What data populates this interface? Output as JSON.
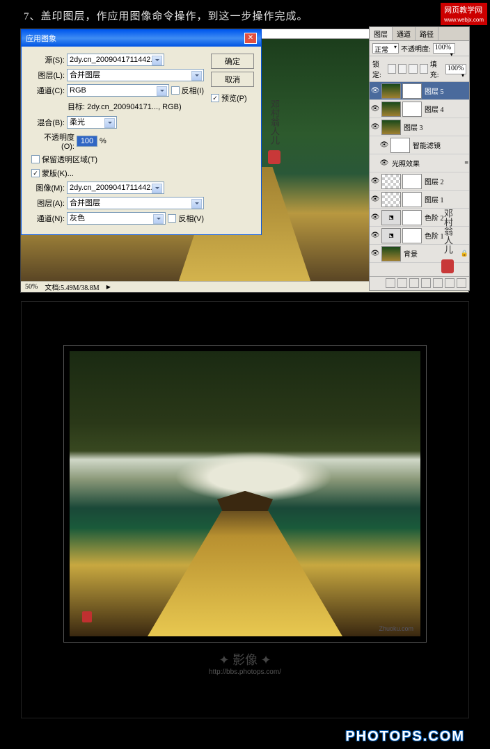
{
  "step_text": "7、盖印图层，作应用图像命令操作，到这一步操作完成。",
  "watermark_top": "网页教学网",
  "watermark_url": "www.webjx.com",
  "dialog": {
    "title": "应用图象",
    "source_lbl": "源(S):",
    "source_val": "2dy.cn_2009041711442...",
    "layer_lbl": "图层(L):",
    "layer_val": "合并图层",
    "channel_lbl": "通道(C):",
    "channel_val": "RGB",
    "invert_lbl": "反相(I)",
    "target_lbl": "目标:",
    "target_val": "2dy.cn_200904171..., RGB)",
    "blend_lbl": "混合(B):",
    "blend_val": "柔光",
    "opacity_lbl": "不透明度(O):",
    "opacity_val": "100",
    "opacity_pct": "%",
    "preserve_lbl": "保留透明区域(T)",
    "mask_lbl": "蒙版(K)...",
    "image_lbl": "图像(M):",
    "image_val": "2dy.cn_2009041711442...",
    "layer2_lbl": "图层(A):",
    "layer2_val": "合并图层",
    "channel2_lbl": "通道(N):",
    "channel2_val": "灰色",
    "invert2_lbl": "反相(V)",
    "ok": "确定",
    "cancel": "取消",
    "preview": "预览(P)"
  },
  "status": {
    "zoom": "50%",
    "doc": "文档:5.49M/38.8M"
  },
  "layers_panel": {
    "tabs": [
      "图层",
      "通道",
      "路径"
    ],
    "mode_lbl": "正常",
    "opacity_lbl": "不透明度:",
    "opacity_val": "100%",
    "lock_lbl": "锁定:",
    "fill_lbl": "填充:",
    "fill_val": "100%",
    "layers": [
      {
        "name": "图层 5",
        "sel": true,
        "thumb": "img",
        "mask": true
      },
      {
        "name": "图层 4",
        "thumb": "img",
        "mask": true
      },
      {
        "name": "图层 3",
        "thumb": "img"
      },
      {
        "name": "智能滤镜",
        "indent": true,
        "thumb": "mask"
      },
      {
        "name": "光照效果",
        "indent": true,
        "fx": true
      },
      {
        "name": "图层 2",
        "thumb": "trans",
        "mask": true
      },
      {
        "name": "图层 1",
        "thumb": "trans",
        "mask": true
      },
      {
        "name": "色阶 2",
        "thumb": "adj",
        "mask": true
      },
      {
        "name": "色阶 1",
        "thumb": "adj",
        "mask": true
      },
      {
        "name": "背景",
        "thumb": "img",
        "lock": true
      }
    ]
  },
  "result": {
    "watermark": "Zhuoku.com",
    "bbs_url": "http://bbs.photops.com/",
    "photops": "PHOTOPS.COM"
  }
}
